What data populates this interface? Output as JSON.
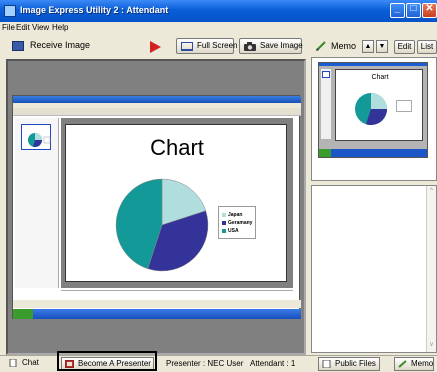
{
  "window": {
    "title": "Image Express Utility 2 : Attendant",
    "minimize_icon": "minimize-icon",
    "maximize_icon": "maximize-icon",
    "close_icon": "close-icon"
  },
  "menu": {
    "file": "File",
    "edit": "Edit",
    "view": "View",
    "help": "Help"
  },
  "toolbar": {
    "receive_label": "Receive Image",
    "full_screen_label": "Full Screen",
    "save_image_label": "Save Image"
  },
  "slide": {
    "title": "Chart",
    "legend": [
      "Japan",
      "Geramany",
      "USA"
    ]
  },
  "chart_data": {
    "type": "pie",
    "title": "Chart",
    "categories": [
      "Japan",
      "Geramany",
      "USA"
    ],
    "values": [
      20,
      35,
      45
    ],
    "colors": [
      "#b0dede",
      "#333399",
      "#149999"
    ],
    "legend_placement": "right"
  },
  "memo": {
    "label": "Memo",
    "up_arrow": "▲",
    "down_arrow": "▼",
    "edit_label": "Edit",
    "list_label": "List",
    "thumb_title": "Chart"
  },
  "status": {
    "chat_label": "Chat",
    "become_presenter_label": "Become A Presenter",
    "presenter_text": "Presenter : NEC User",
    "attendant_text": "Attendant : 1",
    "public_files_label": "Public Files",
    "memo_label": "Memo"
  },
  "colors": {
    "title_bar": "#0a5fd8",
    "accent": "#3a5aa8"
  }
}
